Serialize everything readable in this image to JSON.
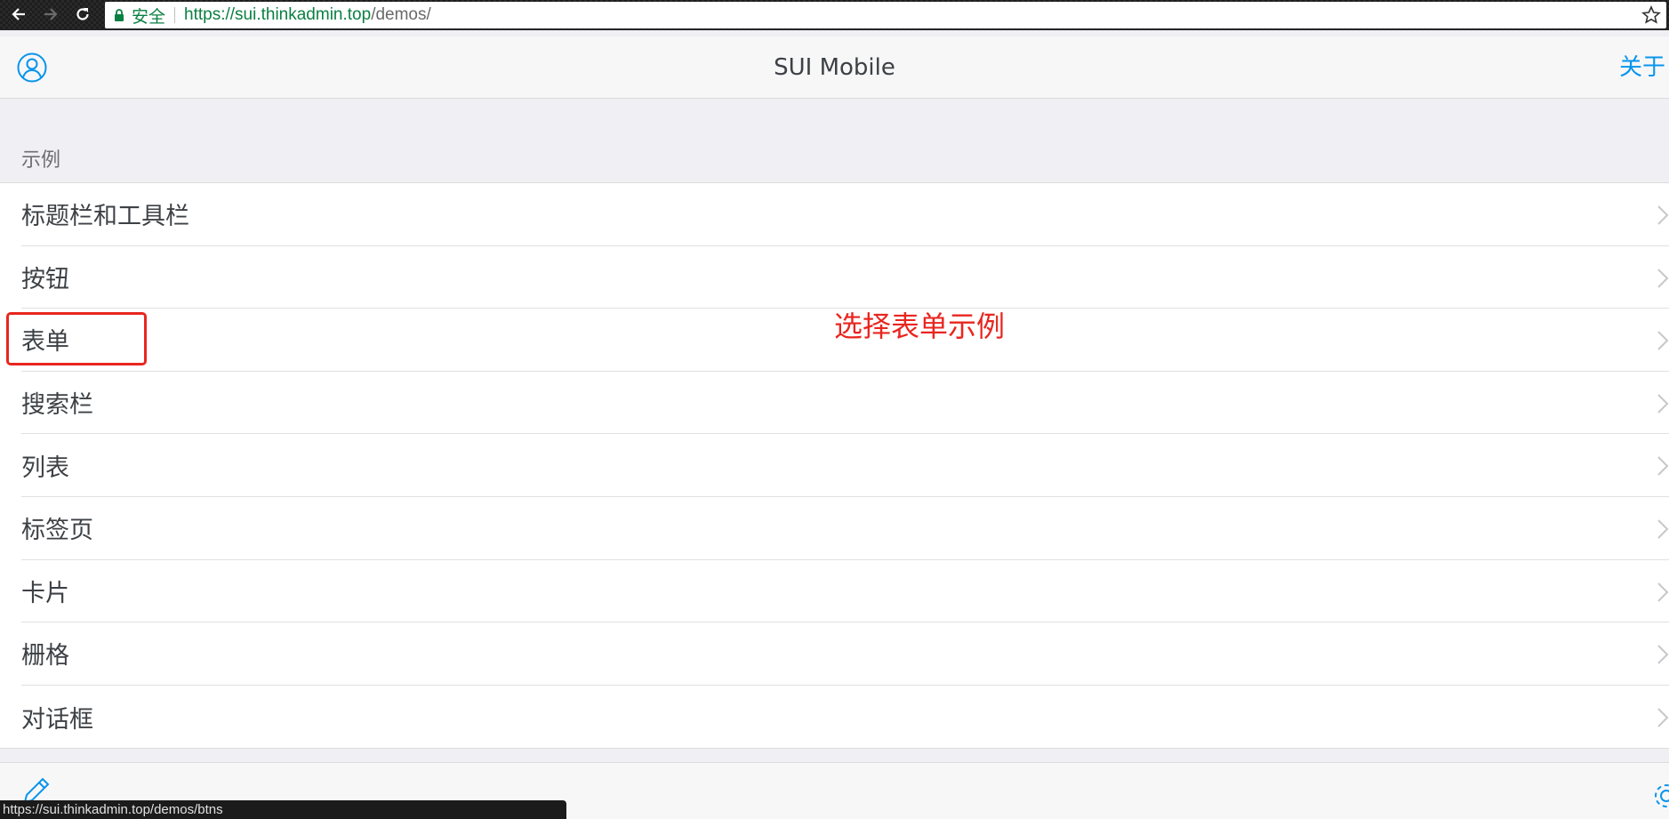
{
  "browser": {
    "secure_label": "安全",
    "url_host": "https://sui.thinkadmin.top",
    "url_path": "/demos/",
    "status_url": "https://sui.thinkadmin.top/demos/btns"
  },
  "header": {
    "title": "SUI Mobile",
    "about_label": "关于"
  },
  "section": {
    "title": "示例"
  },
  "list": {
    "items": [
      {
        "label": "标题栏和工具栏"
      },
      {
        "label": "按钮"
      },
      {
        "label": "表单"
      },
      {
        "label": "搜索栏"
      },
      {
        "label": "列表"
      },
      {
        "label": "标签页"
      },
      {
        "label": "卡片"
      },
      {
        "label": "栅格"
      },
      {
        "label": "对话框"
      }
    ]
  },
  "annotation": {
    "text": "选择表单示例",
    "color": "#e8261f"
  },
  "colors": {
    "accent": "#0894ec",
    "text": "#3d4145",
    "secure": "#0b8043"
  }
}
